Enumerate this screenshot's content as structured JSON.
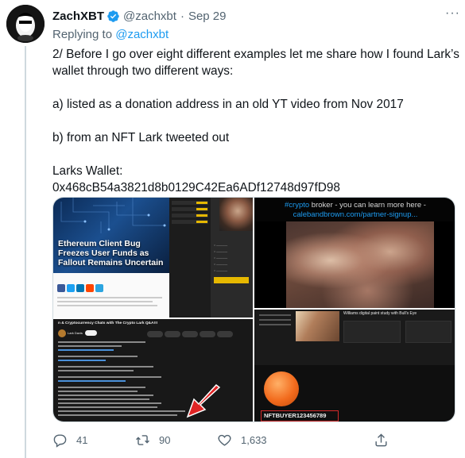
{
  "tweet": {
    "author_name": "ZachXBT",
    "author_handle": "@zachxbt",
    "separator": "·",
    "date": "Sep 29",
    "more_label": "···",
    "reply_prefix": "Replying to",
    "reply_mention": "@zachxbt",
    "text_lines": [
      "2/ Before I go over eight different examples let me share how I found Lark’s",
      "wallet through two different ways:",
      "a) listed as a donation address in an old YT video from Nov 2017",
      "b) from an NFT Lark tweeted out",
      "Larks Wallet:",
      "0x468cB54a3821d8b0129C42Ea6ADf12748d97fD98"
    ]
  },
  "media": {
    "top_left": {
      "headline": "Ethereum Client Bug Freezes User Funds as Fallout Remains Uncertain"
    },
    "bottom_left": {
      "video_title": "n & Cryptocurrency Chats with The Crypto Lark Q&A!!!",
      "channel": "Lark Davis"
    },
    "top_right": {
      "hashtag": "#crypto",
      "caption": " broker - you can learn more here -",
      "url": "calebandbrown.com/partner-signup..."
    },
    "bottom_right": {
      "title": "Williams digital paint study with Bull's Eye",
      "nft_name": "NFTBUYER123456789"
    }
  },
  "actions": {
    "replies": "41",
    "retweets": "90",
    "likes": "1,633"
  },
  "colors": {
    "accent": "#1d9bf0",
    "secondary_text": "#536471",
    "verified": "#1d9bf0",
    "retweet_icon": "#536471",
    "highlight_box": "#d32a2a"
  },
  "icons": [
    "verified-badge-icon",
    "more-icon",
    "reply-icon",
    "retweet-icon",
    "like-icon",
    "share-icon"
  ]
}
